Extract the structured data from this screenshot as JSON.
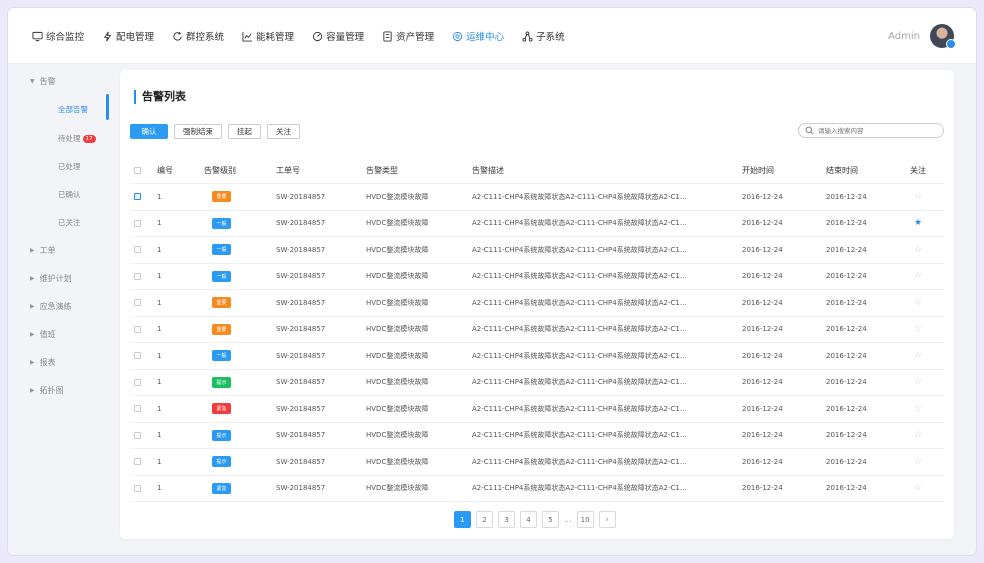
{
  "nav": [
    {
      "label": "综合监控",
      "icon": "monitor-icon"
    },
    {
      "label": "配电管理",
      "icon": "lightning-icon"
    },
    {
      "label": "群控系统",
      "icon": "refresh-icon"
    },
    {
      "label": "能耗管理",
      "icon": "chart-icon"
    },
    {
      "label": "容量管理",
      "icon": "gauge-icon"
    },
    {
      "label": "资产管理",
      "icon": "asset-icon"
    },
    {
      "label": "运维中心",
      "icon": "ops-icon",
      "active": true
    },
    {
      "label": "子系统",
      "icon": "network-icon"
    }
  ],
  "user": {
    "name": "Admin"
  },
  "sidebar": {
    "groups": [
      "告警",
      "工单",
      "维护计划",
      "应急演练",
      "值班",
      "报表",
      "拓扑图"
    ],
    "alarm_items": [
      {
        "label": "全部告警",
        "active": true
      },
      {
        "label": "待处理",
        "badge": "17"
      },
      {
        "label": "已处理"
      },
      {
        "label": "已确认"
      },
      {
        "label": "已关注"
      }
    ]
  },
  "card": {
    "title": "告警列表",
    "buttons": {
      "confirm": "确认",
      "force_end": "强制结束",
      "suspend": "挂起",
      "follow": "关注"
    },
    "search_placeholder": "请输入搜索内容"
  },
  "table": {
    "headers": {
      "no": "编号",
      "level": "告警级别",
      "order": "工单号",
      "type": "告警类型",
      "desc": "告警描述",
      "start": "开始时间",
      "end": "结束时间",
      "follow": "关注"
    },
    "level_colors": {
      "提示": "#1bbf5e",
      "一般": "#2b9af3",
      "重要": "#f58a1f",
      "紧急": "#f03e3e"
    },
    "rows": [
      {
        "no": "1",
        "level": "重要",
        "level_color": "#f58a1f",
        "order": "SW-20184857",
        "type": "HVDC整流模块故障",
        "desc": "A2-C111-CHP4系统故障状态A2-C111-CHP4系统故障状态A2-C1...",
        "start": "2016-12-24",
        "end": "2016-12-24",
        "checked": true,
        "starred": false
      },
      {
        "no": "1",
        "level": "一般",
        "level_color": "#2b9af3",
        "order": "SW-20184857",
        "type": "HVDC整流模块故障",
        "desc": "A2-C111-CHP4系统故障状态A2-C111-CHP4系统故障状态A2-C1...",
        "start": "2016-12-24",
        "end": "2016-12-24",
        "checked": false,
        "starred": true
      },
      {
        "no": "1",
        "level": "一般",
        "level_color": "#2b9af3",
        "order": "SW-20184857",
        "type": "HVDC整流模块故障",
        "desc": "A2-C111-CHP4系统故障状态A2-C111-CHP4系统故障状态A2-C1...",
        "start": "2016-12-24",
        "end": "2016-12-24",
        "checked": false,
        "starred": false
      },
      {
        "no": "1",
        "level": "一般",
        "level_color": "#2b9af3",
        "order": "SW-20184857",
        "type": "HVDC整流模块故障",
        "desc": "A2-C111-CHP4系统故障状态A2-C111-CHP4系统故障状态A2-C1...",
        "start": "2016-12-24",
        "end": "2016-12-24",
        "checked": false,
        "starred": false
      },
      {
        "no": "1",
        "level": "重要",
        "level_color": "#f58a1f",
        "order": "SW-20184857",
        "type": "HVDC整流模块故障",
        "desc": "A2-C111-CHP4系统故障状态A2-C111-CHP4系统故障状态A2-C1...",
        "start": "2016-12-24",
        "end": "2016-12-24",
        "checked": false,
        "starred": false
      },
      {
        "no": "1",
        "level": "重要",
        "level_color": "#f58a1f",
        "order": "SW-20184857",
        "type": "HVDC整流模块故障",
        "desc": "A2-C111-CHP4系统故障状态A2-C111-CHP4系统故障状态A2-C1...",
        "start": "2016-12-24",
        "end": "2016-12-24",
        "checked": false,
        "starred": false
      },
      {
        "no": "1",
        "level": "一般",
        "level_color": "#2b9af3",
        "order": "SW-20184857",
        "type": "HVDC整流模块故障",
        "desc": "A2-C111-CHP4系统故障状态A2-C111-CHP4系统故障状态A2-C1...",
        "start": "2016-12-24",
        "end": "2016-12-24",
        "checked": false,
        "starred": false
      },
      {
        "no": "1",
        "level": "提示",
        "level_color": "#1bbf5e",
        "order": "SW-20184857",
        "type": "HVDC整流模块故障",
        "desc": "A2-C111-CHP4系统故障状态A2-C111-CHP4系统故障状态A2-C1...",
        "start": "2016-12-24",
        "end": "2016-12-24",
        "checked": false,
        "starred": false
      },
      {
        "no": "1",
        "level": "紧急",
        "level_color": "#f03e3e",
        "order": "SW-20184857",
        "type": "HVDC整流模块故障",
        "desc": "A2-C111-CHP4系统故障状态A2-C111-CHP4系统故障状态A2-C1...",
        "start": "2016-12-24",
        "end": "2016-12-24",
        "checked": false,
        "starred": false
      },
      {
        "no": "1",
        "level": "提示",
        "level_color": "#2b9af3",
        "order": "SW-20184857",
        "type": "HVDC整流模块故障",
        "desc": "A2-C111-CHP4系统故障状态A2-C111-CHP4系统故障状态A2-C1...",
        "start": "2016-12-24",
        "end": "2016-12-24",
        "checked": false,
        "starred": false
      },
      {
        "no": "1",
        "level": "提示",
        "level_color": "#2b9af3",
        "order": "SW-20184857",
        "type": "HVDC整流模块故障",
        "desc": "A2-C111-CHP4系统故障状态A2-C111-CHP4系统故障状态A2-C1...",
        "start": "2016-12-24",
        "end": "2016-12-24",
        "checked": false,
        "starred": false
      },
      {
        "no": "1",
        "level": "紧急",
        "level_color": "#2b9af3",
        "order": "SW-20184857",
        "type": "HVDC整流模块故障",
        "desc": "A2-C111-CHP4系统故障状态A2-C111-CHP4系统故障状态A2-C1...",
        "start": "2016-12-24",
        "end": "2016-12-24",
        "checked": false,
        "starred": false
      }
    ]
  },
  "pager": {
    "pages": [
      "1",
      "2",
      "3",
      "4",
      "5"
    ],
    "ellipsis": "...",
    "last": "10",
    "current": "1"
  }
}
